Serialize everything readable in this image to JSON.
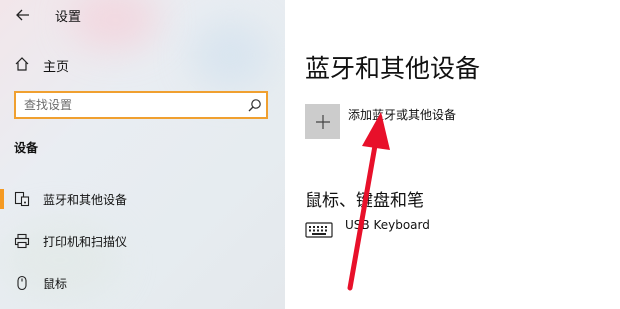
{
  "window": {
    "title": "设置"
  },
  "sidebar": {
    "home_label": "主页",
    "search_placeholder": "查找设置",
    "section_label": "设备",
    "items": [
      {
        "label": "蓝牙和其他设备",
        "icon": "bluetooth-devices-icon",
        "active": true
      },
      {
        "label": "打印机和扫描仪",
        "icon": "printer-icon",
        "active": false
      },
      {
        "label": "鼠标",
        "icon": "mouse-icon",
        "active": false
      }
    ]
  },
  "main": {
    "title": "蓝牙和其他设备",
    "add_device_label": "添加蓝牙或其他设备",
    "section_title": "鼠标、键盘和笔",
    "devices": [
      {
        "name": "USB Keyboard",
        "icon": "keyboard-icon"
      }
    ]
  },
  "colors": {
    "accent": "#f59a23",
    "search_border": "#f0a030",
    "annotation_arrow": "#e8102a"
  }
}
